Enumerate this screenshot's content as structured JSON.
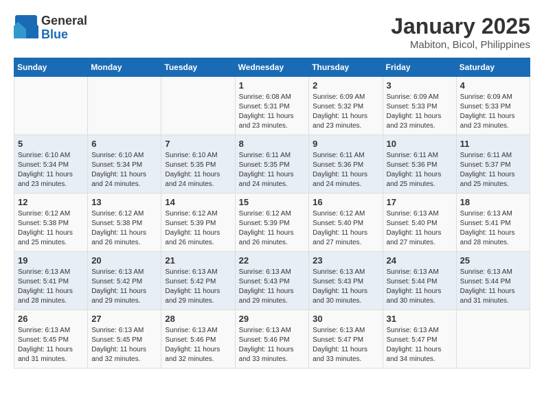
{
  "header": {
    "logo_general": "General",
    "logo_blue": "Blue",
    "title": "January 2025",
    "subtitle": "Mabiton, Bicol, Philippines"
  },
  "days_of_week": [
    "Sunday",
    "Monday",
    "Tuesday",
    "Wednesday",
    "Thursday",
    "Friday",
    "Saturday"
  ],
  "weeks": [
    [
      {
        "day": "",
        "sunrise": "",
        "sunset": "",
        "daylight": ""
      },
      {
        "day": "",
        "sunrise": "",
        "sunset": "",
        "daylight": ""
      },
      {
        "day": "",
        "sunrise": "",
        "sunset": "",
        "daylight": ""
      },
      {
        "day": "1",
        "sunrise": "Sunrise: 6:08 AM",
        "sunset": "Sunset: 5:31 PM",
        "daylight": "Daylight: 11 hours and 23 minutes."
      },
      {
        "day": "2",
        "sunrise": "Sunrise: 6:09 AM",
        "sunset": "Sunset: 5:32 PM",
        "daylight": "Daylight: 11 hours and 23 minutes."
      },
      {
        "day": "3",
        "sunrise": "Sunrise: 6:09 AM",
        "sunset": "Sunset: 5:33 PM",
        "daylight": "Daylight: 11 hours and 23 minutes."
      },
      {
        "day": "4",
        "sunrise": "Sunrise: 6:09 AM",
        "sunset": "Sunset: 5:33 PM",
        "daylight": "Daylight: 11 hours and 23 minutes."
      }
    ],
    [
      {
        "day": "5",
        "sunrise": "Sunrise: 6:10 AM",
        "sunset": "Sunset: 5:34 PM",
        "daylight": "Daylight: 11 hours and 23 minutes."
      },
      {
        "day": "6",
        "sunrise": "Sunrise: 6:10 AM",
        "sunset": "Sunset: 5:34 PM",
        "daylight": "Daylight: 11 hours and 24 minutes."
      },
      {
        "day": "7",
        "sunrise": "Sunrise: 6:10 AM",
        "sunset": "Sunset: 5:35 PM",
        "daylight": "Daylight: 11 hours and 24 minutes."
      },
      {
        "day": "8",
        "sunrise": "Sunrise: 6:11 AM",
        "sunset": "Sunset: 5:35 PM",
        "daylight": "Daylight: 11 hours and 24 minutes."
      },
      {
        "day": "9",
        "sunrise": "Sunrise: 6:11 AM",
        "sunset": "Sunset: 5:36 PM",
        "daylight": "Daylight: 11 hours and 24 minutes."
      },
      {
        "day": "10",
        "sunrise": "Sunrise: 6:11 AM",
        "sunset": "Sunset: 5:36 PM",
        "daylight": "Daylight: 11 hours and 25 minutes."
      },
      {
        "day": "11",
        "sunrise": "Sunrise: 6:11 AM",
        "sunset": "Sunset: 5:37 PM",
        "daylight": "Daylight: 11 hours and 25 minutes."
      }
    ],
    [
      {
        "day": "12",
        "sunrise": "Sunrise: 6:12 AM",
        "sunset": "Sunset: 5:38 PM",
        "daylight": "Daylight: 11 hours and 25 minutes."
      },
      {
        "day": "13",
        "sunrise": "Sunrise: 6:12 AM",
        "sunset": "Sunset: 5:38 PM",
        "daylight": "Daylight: 11 hours and 26 minutes."
      },
      {
        "day": "14",
        "sunrise": "Sunrise: 6:12 AM",
        "sunset": "Sunset: 5:39 PM",
        "daylight": "Daylight: 11 hours and 26 minutes."
      },
      {
        "day": "15",
        "sunrise": "Sunrise: 6:12 AM",
        "sunset": "Sunset: 5:39 PM",
        "daylight": "Daylight: 11 hours and 26 minutes."
      },
      {
        "day": "16",
        "sunrise": "Sunrise: 6:12 AM",
        "sunset": "Sunset: 5:40 PM",
        "daylight": "Daylight: 11 hours and 27 minutes."
      },
      {
        "day": "17",
        "sunrise": "Sunrise: 6:13 AM",
        "sunset": "Sunset: 5:40 PM",
        "daylight": "Daylight: 11 hours and 27 minutes."
      },
      {
        "day": "18",
        "sunrise": "Sunrise: 6:13 AM",
        "sunset": "Sunset: 5:41 PM",
        "daylight": "Daylight: 11 hours and 28 minutes."
      }
    ],
    [
      {
        "day": "19",
        "sunrise": "Sunrise: 6:13 AM",
        "sunset": "Sunset: 5:41 PM",
        "daylight": "Daylight: 11 hours and 28 minutes."
      },
      {
        "day": "20",
        "sunrise": "Sunrise: 6:13 AM",
        "sunset": "Sunset: 5:42 PM",
        "daylight": "Daylight: 11 hours and 29 minutes."
      },
      {
        "day": "21",
        "sunrise": "Sunrise: 6:13 AM",
        "sunset": "Sunset: 5:42 PM",
        "daylight": "Daylight: 11 hours and 29 minutes."
      },
      {
        "day": "22",
        "sunrise": "Sunrise: 6:13 AM",
        "sunset": "Sunset: 5:43 PM",
        "daylight": "Daylight: 11 hours and 29 minutes."
      },
      {
        "day": "23",
        "sunrise": "Sunrise: 6:13 AM",
        "sunset": "Sunset: 5:43 PM",
        "daylight": "Daylight: 11 hours and 30 minutes."
      },
      {
        "day": "24",
        "sunrise": "Sunrise: 6:13 AM",
        "sunset": "Sunset: 5:44 PM",
        "daylight": "Daylight: 11 hours and 30 minutes."
      },
      {
        "day": "25",
        "sunrise": "Sunrise: 6:13 AM",
        "sunset": "Sunset: 5:44 PM",
        "daylight": "Daylight: 11 hours and 31 minutes."
      }
    ],
    [
      {
        "day": "26",
        "sunrise": "Sunrise: 6:13 AM",
        "sunset": "Sunset: 5:45 PM",
        "daylight": "Daylight: 11 hours and 31 minutes."
      },
      {
        "day": "27",
        "sunrise": "Sunrise: 6:13 AM",
        "sunset": "Sunset: 5:45 PM",
        "daylight": "Daylight: 11 hours and 32 minutes."
      },
      {
        "day": "28",
        "sunrise": "Sunrise: 6:13 AM",
        "sunset": "Sunset: 5:46 PM",
        "daylight": "Daylight: 11 hours and 32 minutes."
      },
      {
        "day": "29",
        "sunrise": "Sunrise: 6:13 AM",
        "sunset": "Sunset: 5:46 PM",
        "daylight": "Daylight: 11 hours and 33 minutes."
      },
      {
        "day": "30",
        "sunrise": "Sunrise: 6:13 AM",
        "sunset": "Sunset: 5:47 PM",
        "daylight": "Daylight: 11 hours and 33 minutes."
      },
      {
        "day": "31",
        "sunrise": "Sunrise: 6:13 AM",
        "sunset": "Sunset: 5:47 PM",
        "daylight": "Daylight: 11 hours and 34 minutes."
      },
      {
        "day": "",
        "sunrise": "",
        "sunset": "",
        "daylight": ""
      }
    ]
  ]
}
